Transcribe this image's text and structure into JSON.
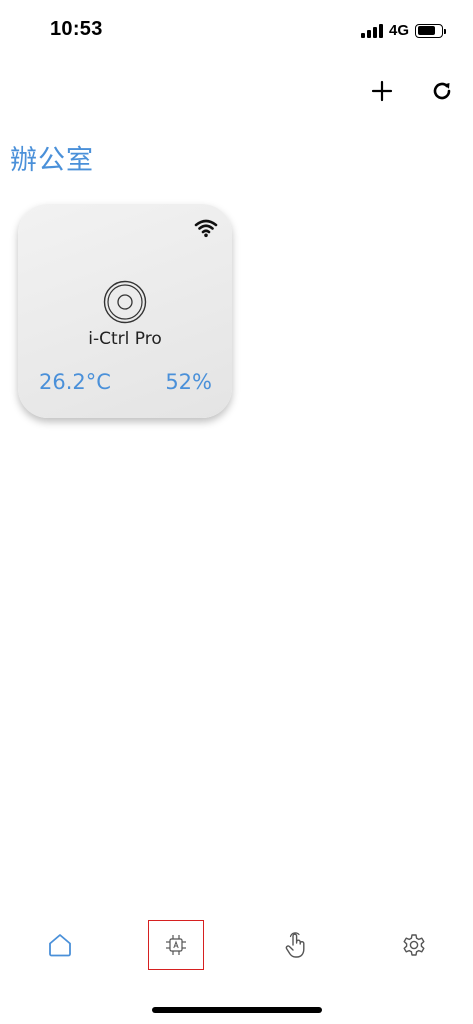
{
  "status_bar": {
    "time": "10:53",
    "network": "4G",
    "icons": [
      "signal-icon",
      "battery-icon"
    ]
  },
  "top_actions": {
    "icons": [
      "add-icon",
      "refresh-icon"
    ]
  },
  "room": {
    "title": "辦公室"
  },
  "device": {
    "name": "i-Ctrl Pro",
    "temperature": "26.2°C",
    "humidity": "52%",
    "status_icon": "wifi-icon",
    "logo_icon": "device-logo-icon"
  },
  "tab_bar": {
    "tabs": [
      {
        "icon": "home-icon",
        "active": true
      },
      {
        "icon": "chip-icon",
        "active": false,
        "highlighted": true
      },
      {
        "icon": "hand-pointer-icon",
        "active": false
      },
      {
        "icon": "gear-icon",
        "active": false
      }
    ]
  },
  "colors": {
    "accent": "#4a90d9",
    "highlight_border": "#d62020",
    "icon_gray": "#555555"
  }
}
